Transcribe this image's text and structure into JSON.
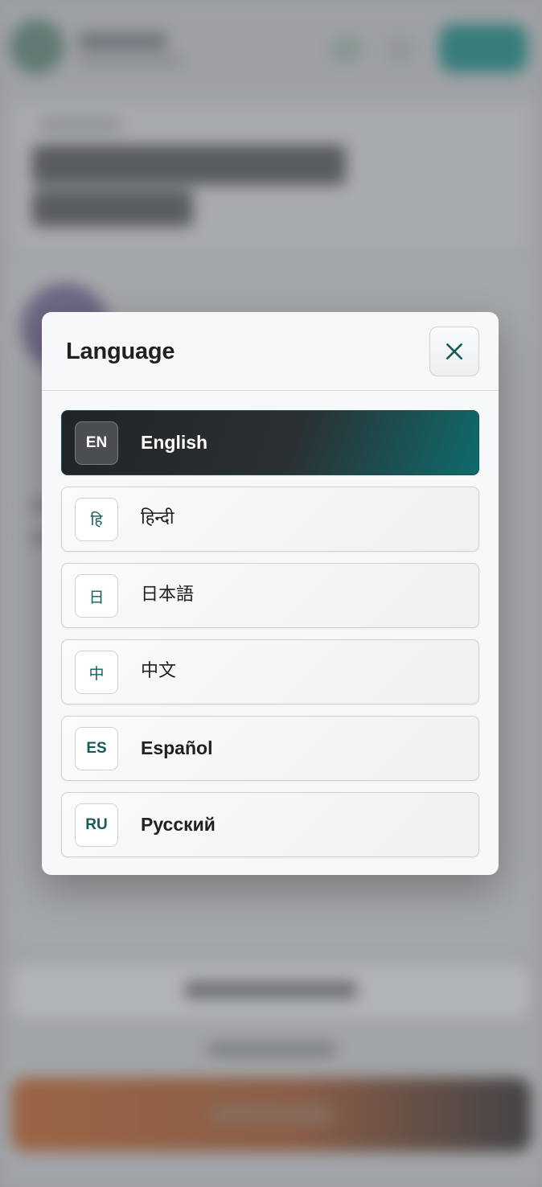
{
  "modal": {
    "title": "Language",
    "close_icon": "close-icon"
  },
  "languages": [
    {
      "code": "EN",
      "name": "English",
      "selected": true
    },
    {
      "code": "हि",
      "name": "हिन्दी",
      "selected": false
    },
    {
      "code": "日",
      "name": "日本語",
      "selected": false
    },
    {
      "code": "中",
      "name": "中文",
      "selected": false
    },
    {
      "code": "ES",
      "name": "Español",
      "selected": false
    },
    {
      "code": "RU",
      "name": "Русский",
      "selected": false
    }
  ],
  "colors": {
    "accent": "#0f6b6b",
    "selected_bg_start": "#202427",
    "text_dark": "#1d2124"
  }
}
